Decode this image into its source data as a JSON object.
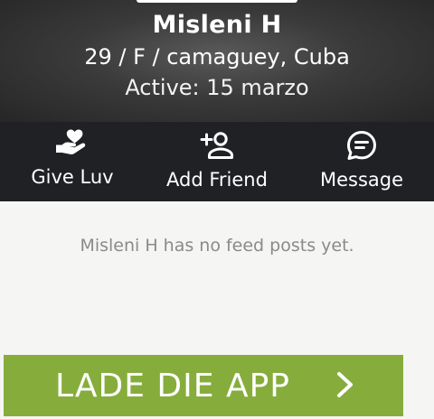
{
  "profile": {
    "name": "Misleni H",
    "details": "29 / F / camaguey, Cuba",
    "active": "Active: 15 marzo"
  },
  "actions": [
    {
      "label": "Give Luv",
      "icon": "hand-heart-icon"
    },
    {
      "label": "Add Friend",
      "icon": "add-person-icon"
    },
    {
      "label": "Message",
      "icon": "chat-bubble-icon"
    }
  ],
  "feed": {
    "empty_message": "Misleni H has no feed posts yet."
  },
  "banner": {
    "label": "LADE DIE APP",
    "icon": "chevron-right-icon",
    "color": "#86ad3c"
  },
  "colors": {
    "action_bar": "#1f2124",
    "background": "#f5f5f3"
  }
}
